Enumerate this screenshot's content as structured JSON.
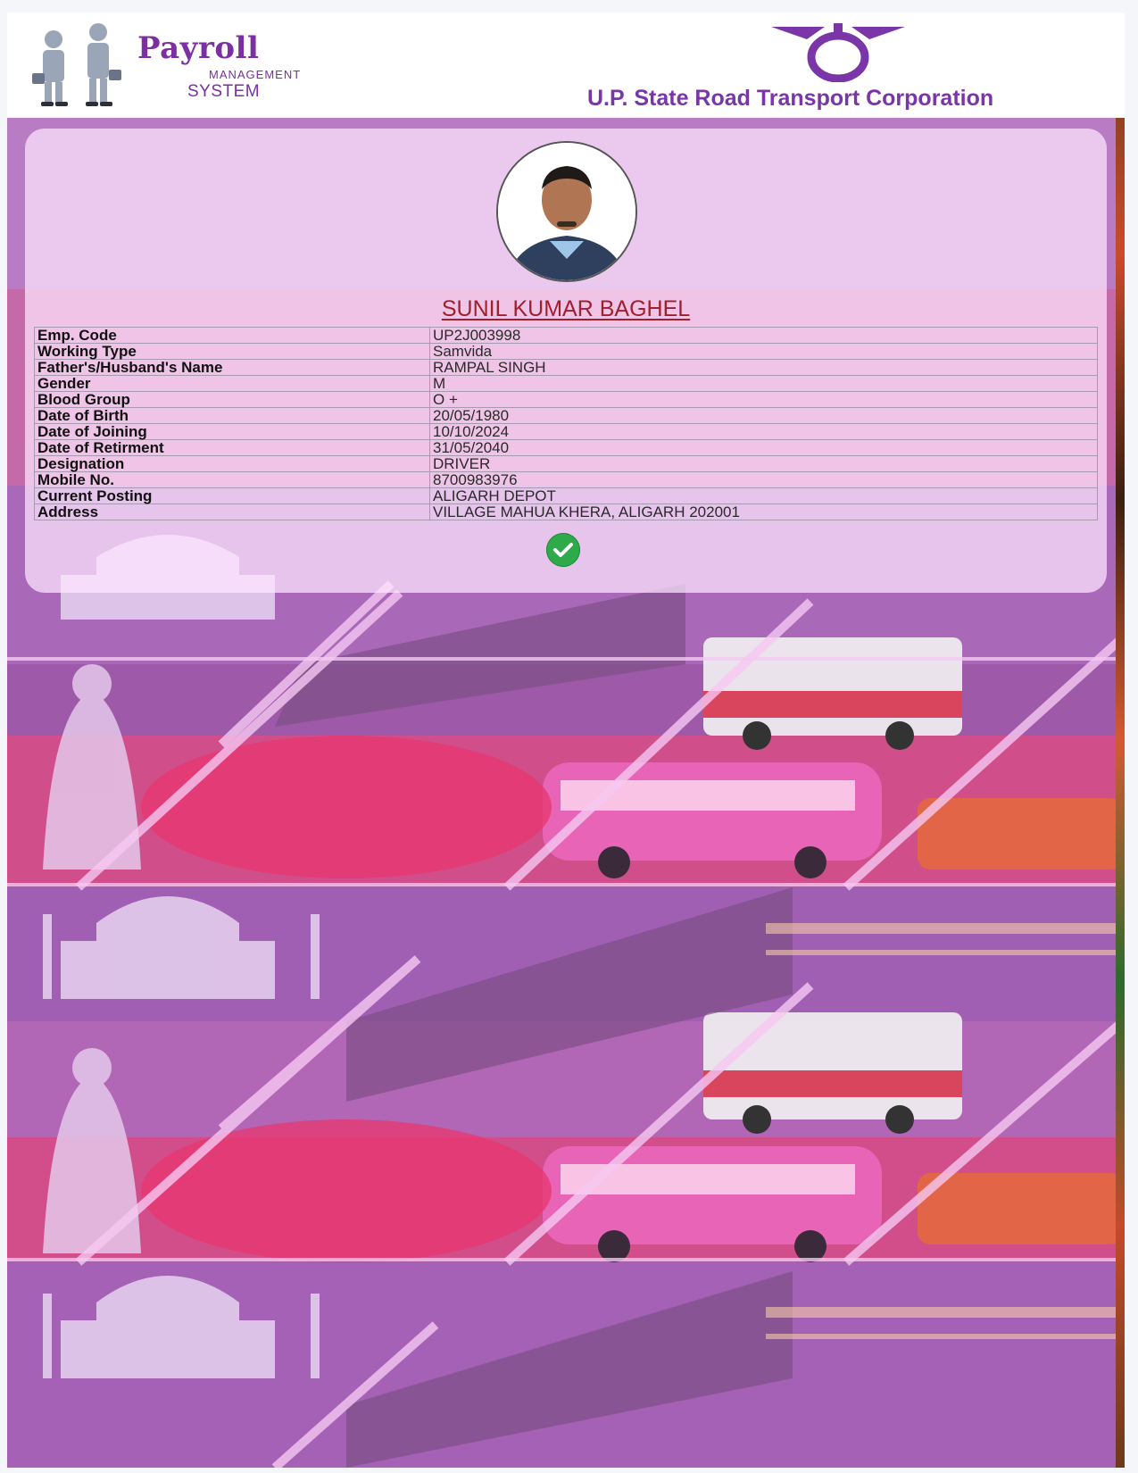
{
  "header": {
    "app_title": "Payroll",
    "app_subtitle_1": "MANAGEMENT",
    "app_subtitle_2": "SYSTEM",
    "organization": "U.P. State Road Transport Corporation"
  },
  "employee": {
    "name": "SUNIL KUMAR BAGHEL",
    "fields": [
      {
        "label": "Emp. Code",
        "value": "UP2J003998"
      },
      {
        "label": "Working Type",
        "value": "Samvida"
      },
      {
        "label": "Father's/Husband's Name",
        "value": "RAMPAL SINGH"
      },
      {
        "label": "Gender",
        "value": "M"
      },
      {
        "label": "Blood Group",
        "value": "O +"
      },
      {
        "label": "Date of Birth",
        "value": "20/05/1980"
      },
      {
        "label": "Date of Joining",
        "value": "10/10/2024"
      },
      {
        "label": "Date of Retirment",
        "value": "31/05/2040"
      },
      {
        "label": "Designation",
        "value": "DRIVER"
      },
      {
        "label": "Mobile No.",
        "value": "8700983976"
      },
      {
        "label": "Current Posting",
        "value": "ALIGARH DEPOT"
      },
      {
        "label": "Address",
        "value": "VILLAGE MAHUA KHERA, ALIGARH 202001"
      }
    ],
    "verified_icon": "check-circle-icon"
  },
  "colors": {
    "brand_purple": "#7b2fa0",
    "name_red": "#a01f2c",
    "verified_green": "#2faa4a"
  }
}
